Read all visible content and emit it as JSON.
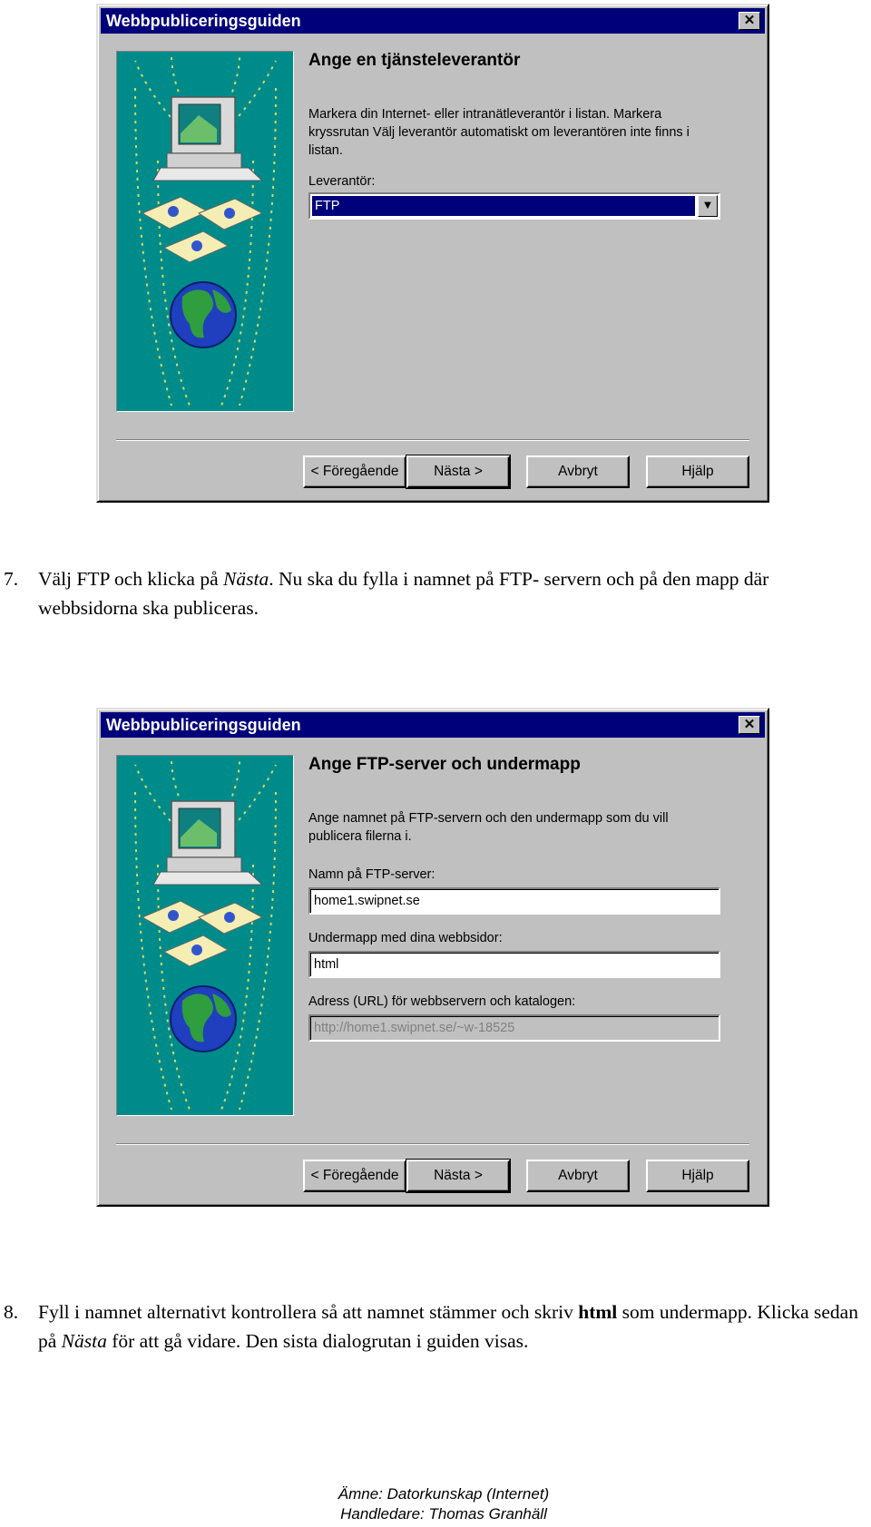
{
  "dialog1": {
    "title": "Webbpubliceringsguiden",
    "close_glyph": "✕",
    "heading": "Ange en tjänsteleverantör",
    "description": "Markera din Internet- eller intranätleverantör i listan. Markera kryssrutan Välj leverantör automatiskt om leverantören inte finns i listan.",
    "provider_label": "Leverantör:",
    "provider_value": "FTP",
    "buttons": {
      "back": "< Föregående",
      "next": "Nästa >",
      "cancel": "Avbryt",
      "help": "Hjälp"
    }
  },
  "step7": {
    "number": "7.",
    "part1": "Välj FTP och klicka på ",
    "italic": "Nästa",
    "part2": ". Nu ska du fylla i namnet på FTP- servern och på den mapp där webbsidorna ska publiceras."
  },
  "dialog2": {
    "title": "Webbpubliceringsguiden",
    "close_glyph": "✕",
    "heading": "Ange FTP-server och undermapp",
    "description": "Ange namnet på FTP-servern och den undermapp som du vill publicera filerna i.",
    "ftp_label": "Namn på FTP-server:",
    "ftp_value": "home1.swipnet.se",
    "subfolder_label": "Undermapp med dina webbsidor:",
    "subfolder_value": "html",
    "url_label": "Adress (URL) för webbservern och katalogen:",
    "url_value": "http://home1.swipnet.se/~w-18525",
    "buttons": {
      "back": "< Föregående",
      "next": "Nästa >",
      "cancel": "Avbryt",
      "help": "Hjälp"
    }
  },
  "step8": {
    "number": "8.",
    "part1": "Fyll i namnet alternativt kontrollera så att namnet stämmer och skriv ",
    "bold": "html",
    "part2": " som undermapp. Klicka sedan på ",
    "italic": "Nästa",
    "part3": " för att gå vidare. Den sista dialogrutan i guiden visas."
  },
  "footer": {
    "subject": "Ämne: Datorkunskap (Internet)",
    "supervisor": "Handledare: Thomas Granhäll"
  },
  "colors": {
    "title_bar": "#00007b",
    "side_panel": "#008b8b",
    "dialog_face": "#c0c0c0"
  }
}
